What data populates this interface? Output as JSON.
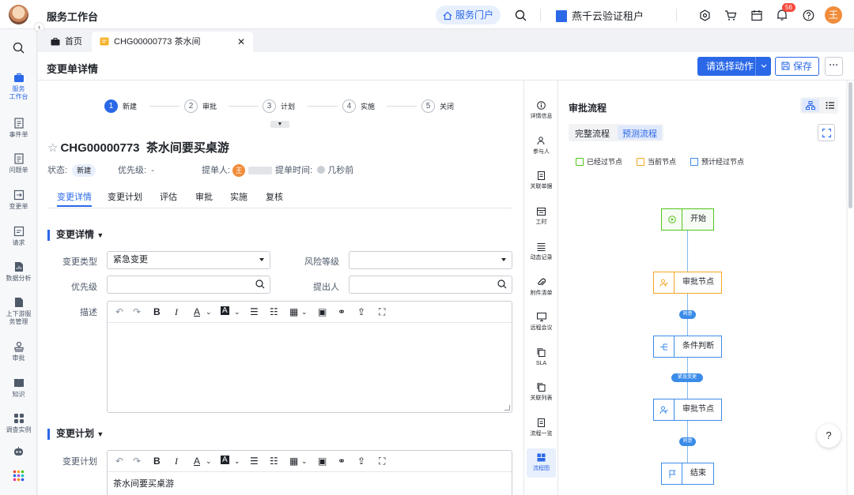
{
  "topbar": {
    "app_title": "服务工作台",
    "portal_label": "服务门户",
    "tenant_name": "燕千云验证租户",
    "notification_count": "56",
    "user_avatar": "王"
  },
  "sidebar": {
    "items": [
      {
        "label": "服务\n工作台",
        "icon": "briefcase-icon"
      },
      {
        "label": "事件单",
        "icon": "doc-icon"
      },
      {
        "label": "问题单",
        "icon": "doc-icon"
      },
      {
        "label": "变更单",
        "icon": "change-icon"
      },
      {
        "label": "请求",
        "icon": "request-icon"
      },
      {
        "label": "数据分析",
        "icon": "analysis-icon"
      },
      {
        "label": "上下游服\n务管理",
        "icon": "doc-icon"
      },
      {
        "label": "审批",
        "icon": "stamp-icon"
      },
      {
        "label": "知识",
        "icon": "book-icon"
      },
      {
        "label": "调查实例",
        "icon": "grid-icon"
      }
    ]
  },
  "tabs": {
    "home": "首页",
    "current": "CHG00000773 茶水间"
  },
  "header": {
    "page_title": "变更单详情",
    "action_button": "请选择动作",
    "save_button": "保存",
    "more_button": "···"
  },
  "steps": [
    {
      "num": "1",
      "label": "新建"
    },
    {
      "num": "2",
      "label": "审批"
    },
    {
      "num": "3",
      "label": "计划"
    },
    {
      "num": "4",
      "label": "实施"
    },
    {
      "num": "5",
      "label": "关闭"
    }
  ],
  "ticket": {
    "id": "CHG00000773",
    "title": "茶水间要买桌游",
    "status_label": "状态:",
    "status": "新建",
    "priority_label": "优先级:",
    "priority": "-",
    "submitter_label": "提单人:",
    "submitter_avatar": "王",
    "submit_time_label": "提单时间:",
    "submit_time": "几秒前"
  },
  "subtabs": [
    "变更详情",
    "变更计划",
    "评估",
    "审批",
    "实施",
    "复核"
  ],
  "details": {
    "section_title": "变更详情",
    "change_type_label": "变更类型",
    "change_type_value": "紧急变更",
    "risk_label": "风险等级",
    "risk_value": "",
    "priority_label": "优先级",
    "submitter_label": "提出人",
    "description_label": "描述"
  },
  "plan": {
    "section_title": "变更计划",
    "plan_label": "变更计划",
    "plan_text": "茶水间要买桌游"
  },
  "rail": [
    {
      "label": "详情信息"
    },
    {
      "label": "参与人"
    },
    {
      "label": "关联单据"
    },
    {
      "label": "工时"
    },
    {
      "label": "动态记录"
    },
    {
      "label": "附件清单"
    },
    {
      "label": "远程会议"
    },
    {
      "label": "SLA"
    },
    {
      "label": "关联列表"
    },
    {
      "label": "流程一览"
    },
    {
      "label": "流程图"
    }
  ],
  "flow": {
    "title": "审批流程",
    "tab_full": "完整流程",
    "tab_predict": "预测流程",
    "legend": [
      {
        "label": "已经过节点",
        "color": "#52c41a"
      },
      {
        "label": "当前节点",
        "color": "#f5a623"
      },
      {
        "label": "预计经过节点",
        "color": "#3b8ce9"
      }
    ],
    "nodes": [
      {
        "label": "开始"
      },
      {
        "label": "审批节点"
      },
      {
        "label": "条件判断"
      },
      {
        "label": "审批节点"
      },
      {
        "label": "结束"
      }
    ],
    "edges": [
      "同意",
      "紧急变更",
      "同意"
    ]
  },
  "colors": {
    "accent": "#2a68e8",
    "passed": "#52c41a",
    "current": "#f5a623",
    "expected": "#3b8ce9"
  }
}
